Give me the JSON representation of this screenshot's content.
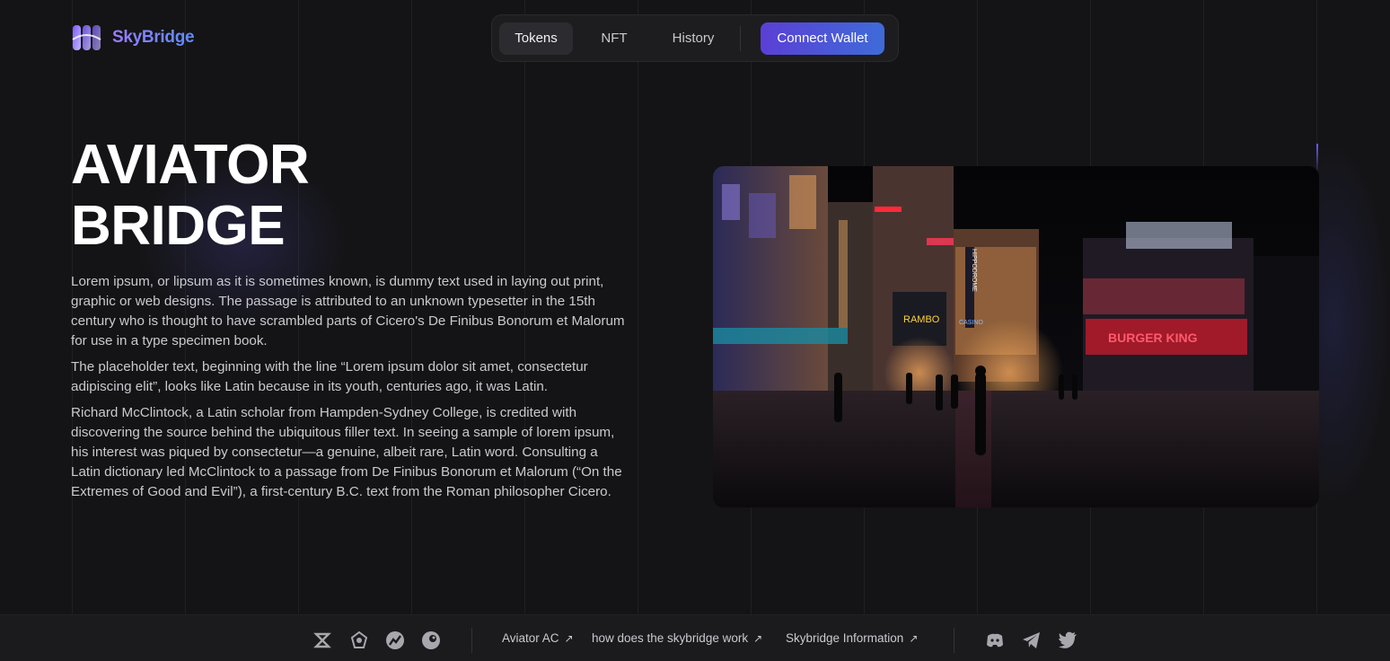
{
  "brand": {
    "name": "SkyBridge",
    "logo_icon": "skybridge-logo-mark"
  },
  "nav": {
    "tabs": [
      {
        "label": "Tokens",
        "active": true
      },
      {
        "label": "NFT",
        "active": false
      },
      {
        "label": "History",
        "active": false
      }
    ],
    "connect_label": "Connect Wallet"
  },
  "hero": {
    "title_line1": "AVIATOR",
    "title_line2": "BRIDGE",
    "paragraphs": [
      "Lorem ipsum, or lipsum as it is sometimes known, is dummy text used in laying out print, graphic or web designs. The passage is attributed to an unknown typesetter in the 15th century who is thought to have scrambled parts of Cicero's De Finibus Bonorum et Malorum for use in a type specimen book.",
      "The placeholder text, beginning with the line “Lorem ipsum dolor sit amet, consectetur adipiscing elit”, looks like Latin because in its youth, centuries ago, it was Latin.",
      "Richard McClintock, a Latin scholar from Hampden-Sydney College, is credited with discovering the source behind the ubiquitous filler text. In seeing a sample of lorem ipsum, his interest was piqued by consectetur—a genuine, albeit rare, Latin word. Consulting a Latin dictionary led McClintock to a passage from De Finibus Bonorum et Malorum (“On the Extremes of Good and Evil”), a first-century B.C. text from the Roman philosopher Cicero."
    ],
    "image_alt_signs": {
      "sign_rambo": "RAMBO",
      "sign_hippodrome": "HIPPODROME",
      "sign_casino": "CASINO",
      "sign_burger": "BURGER KING"
    }
  },
  "footer": {
    "left_icons": [
      "dextools-icon",
      "coinmarketcap-icon",
      "coingecko-icon",
      "etherscan-icon"
    ],
    "links": [
      {
        "label": "Aviator AC",
        "arrow": "↗"
      },
      {
        "label": "how does the skybridge work",
        "arrow": "↗"
      },
      {
        "label": "Skybridge Information",
        "arrow": "↗"
      }
    ],
    "social_icons": [
      "discord-icon",
      "telegram-icon",
      "twitter-icon"
    ]
  },
  "colors": {
    "background": "#141416",
    "accent_start": "#5b3fd6",
    "accent_end": "#3f6bd8",
    "text": "#c9c9cf"
  }
}
